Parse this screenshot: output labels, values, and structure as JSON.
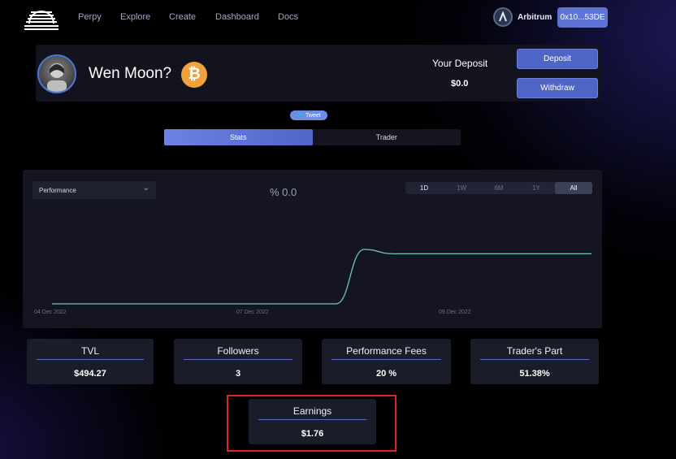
{
  "nav": {
    "links": [
      "Perpy",
      "Explore",
      "Create",
      "Dashboard",
      "Docs"
    ],
    "network": "Arbitrum",
    "wallet": "0x10...53DE"
  },
  "profile": {
    "name": "Wen Moon?",
    "token_symbol": "₿",
    "deposit_label": "Your Deposit",
    "deposit_value": "$0.0",
    "deposit_button": "Deposit",
    "withdraw_button": "Withdraw"
  },
  "tweet_label": "Tweet",
  "tabs": [
    "Stats",
    "Trader"
  ],
  "performance": {
    "select_label": "Performance",
    "value": "% 0.0",
    "ranges": [
      "1D",
      "1W",
      "6M",
      "1Y",
      "All"
    ]
  },
  "chart_data": {
    "type": "line",
    "x_tick_labels": [
      "04 Dec 2022",
      "07 Dec 2022",
      "09 Dec 2022"
    ],
    "series": [
      {
        "values": [
          0,
          0,
          0,
          0,
          0,
          0,
          0,
          0,
          0,
          0,
          0,
          1.0,
          0.92,
          0.92,
          0.92,
          0.92,
          0.92,
          0.92,
          0.92,
          0.92
        ]
      }
    ],
    "line_color": "#6ec9b8",
    "grid": false
  },
  "stats": [
    {
      "label": "TVL",
      "value": "$494.27"
    },
    {
      "label": "Followers",
      "value": "3"
    },
    {
      "label": "Performance Fees",
      "value": "20 %"
    },
    {
      "label": "Trader's Part",
      "value": "51.38%"
    }
  ],
  "earnings": {
    "label": "Earnings",
    "value": "$1.76"
  },
  "colors": {
    "accent": "#5d73d6",
    "highlight": "#e02424"
  }
}
